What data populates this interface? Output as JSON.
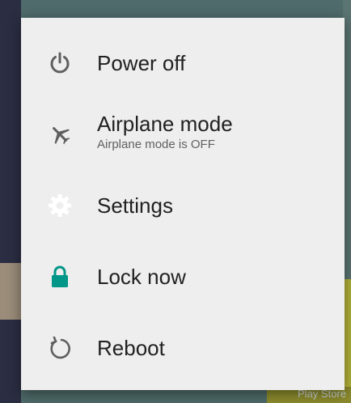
{
  "menu": {
    "items": [
      {
        "label": "Power off",
        "icon": "power-icon"
      },
      {
        "label": "Airplane mode",
        "sublabel": "Airplane mode is OFF",
        "icon": "airplane-icon"
      },
      {
        "label": "Settings",
        "icon": "gear-icon"
      },
      {
        "label": "Lock now",
        "icon": "lock-icon"
      },
      {
        "label": "Reboot",
        "icon": "reboot-icon"
      }
    ]
  },
  "background": {
    "play_store_label": "Play Store"
  },
  "colors": {
    "dialog_bg": "#eeeeee",
    "icon_gray": "#5f5f5f",
    "lock_green": "#009688"
  }
}
